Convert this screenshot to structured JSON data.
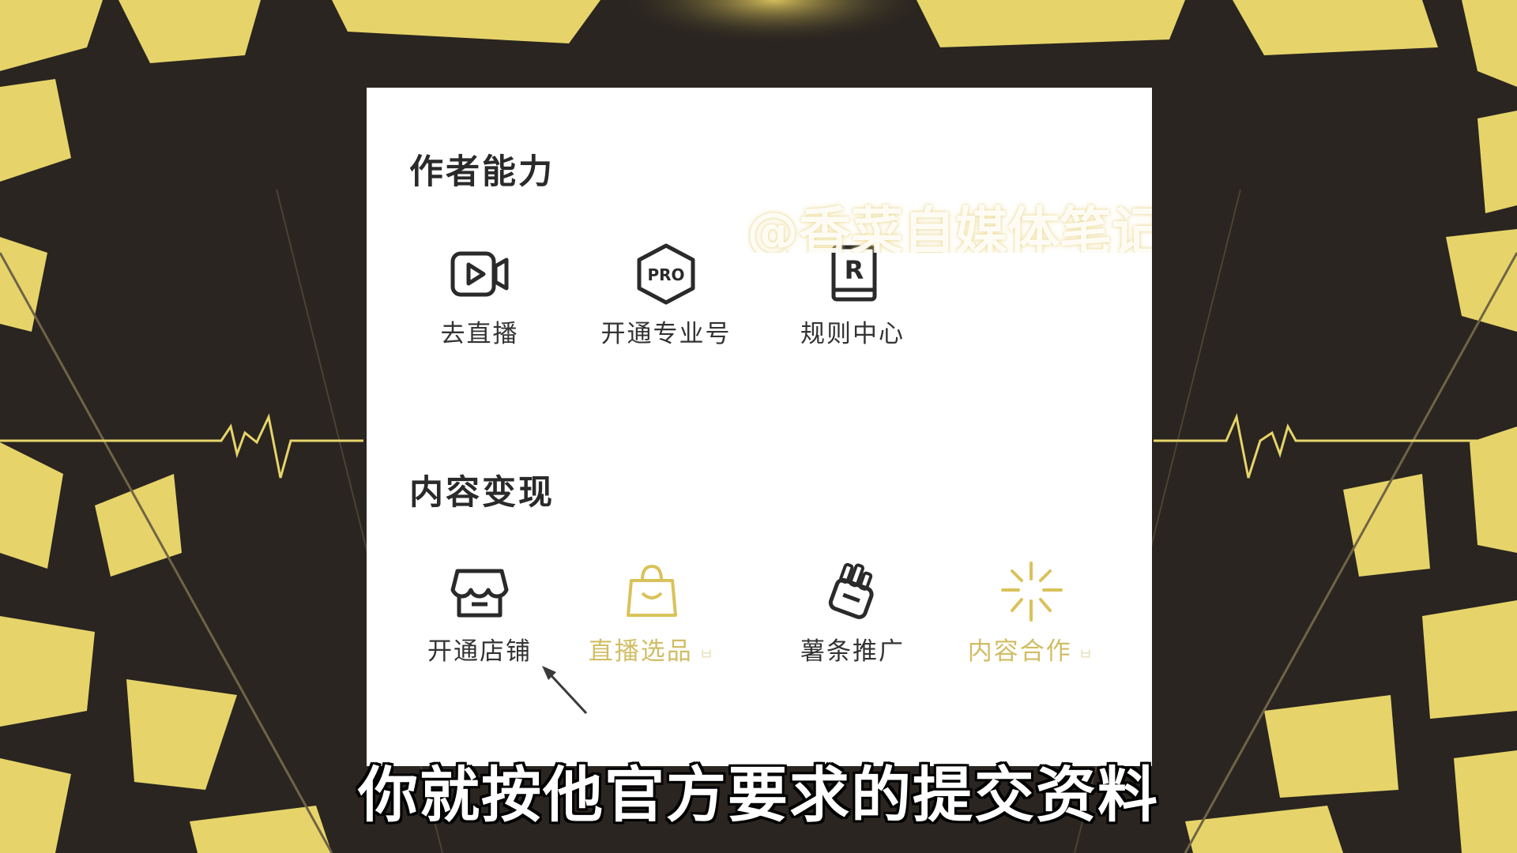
{
  "colors": {
    "background": "#2a2520",
    "accent_yellow": "#e6d46a",
    "icon_dark": "#2a2a2a",
    "icon_gold": "#d9c25a"
  },
  "author_section": {
    "title": "作者能力",
    "items": [
      {
        "label": "去直播",
        "icon": "live-video-icon"
      },
      {
        "label": "开通专业号",
        "icon": "pro-hexagon-icon"
      },
      {
        "label": "规则中心",
        "icon": "rule-book-icon"
      }
    ]
  },
  "monetize_section": {
    "title": "内容变现",
    "items": [
      {
        "label": "开通店铺",
        "icon": "store-icon"
      },
      {
        "label": "直播选品",
        "icon": "shopping-bag-icon",
        "suffix": "ㅂ"
      },
      {
        "label": "薯条推广",
        "icon": "fries-promote-icon"
      },
      {
        "label": "内容合作",
        "icon": "sparkle-icon",
        "suffix": "ㅂ"
      }
    ]
  },
  "watermark": "@香菜自媒体笔记",
  "subtitle": "你就按他官方要求的提交资料"
}
